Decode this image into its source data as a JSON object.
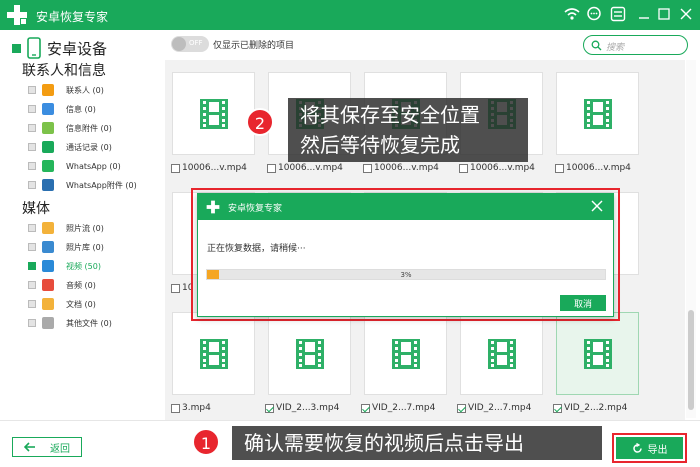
{
  "window": {
    "title": "安卓恢复专家",
    "brand_color": "#19a95a",
    "alert_color": "#e8262e"
  },
  "sidebar": {
    "device_label": "安卓设备",
    "sections": [
      {
        "title": "联系人和信息",
        "items": [
          {
            "label": "联系人 (0)",
            "icon": "contacts-icon",
            "color": "#f39c12"
          },
          {
            "label": "信息 (0)",
            "icon": "message-icon",
            "color": "#3b8de0"
          },
          {
            "label": "信息附件 (0)",
            "icon": "attachment-icon",
            "color": "#7cc24a"
          },
          {
            "label": "通话记录 (0)",
            "icon": "call-log-icon",
            "color": "#19a95a"
          },
          {
            "label": "WhatsApp (0)",
            "icon": "whatsapp-icon",
            "color": "#25b65b"
          },
          {
            "label": "WhatsApp附件 (0)",
            "icon": "whatsapp-attachment-icon",
            "color": "#2a6fb0"
          }
        ]
      },
      {
        "title": "媒体",
        "items": [
          {
            "label": "照片流 (0)",
            "icon": "photo-stream-icon",
            "color": "#f3b23a"
          },
          {
            "label": "照片库 (0)",
            "icon": "photo-library-icon",
            "color": "#3a8ad0"
          },
          {
            "label": "视频 (50)",
            "icon": "video-icon",
            "color": "#2a8ad8",
            "active": true
          },
          {
            "label": "音频 (0)",
            "icon": "audio-icon",
            "color": "#e74c3c"
          },
          {
            "label": "文档 (0)",
            "icon": "document-icon",
            "color": "#f3b23a"
          },
          {
            "label": "其他文件 (0)",
            "icon": "other-files-icon",
            "color": "#aaaaaa"
          }
        ]
      }
    ]
  },
  "topbar": {
    "toggle_label": "OFF",
    "only_deleted_label": "仅显示已删除的项目",
    "search_placeholder": "搜索"
  },
  "grid": {
    "row1": [
      "10006...v.mp4",
      "10006...v.mp4",
      "10006...v.mp4",
      "10006...v.mp4",
      "10006...v.mp4"
    ],
    "row2_first": "10",
    "row3": [
      {
        "label": "3.mp4",
        "checked": false
      },
      {
        "label": "VID_2...3.mp4",
        "checked": true
      },
      {
        "label": "VID_2...7.mp4",
        "checked": true
      },
      {
        "label": "VID_2...7.mp4",
        "checked": true
      },
      {
        "label": "VID_2...2.mp4",
        "checked": true
      }
    ]
  },
  "dialog": {
    "title": "安卓恢复专家",
    "message": "正在恢复数据，请稍候···",
    "progress_percent": 3,
    "progress_label": "3%",
    "cancel_label": "取消"
  },
  "bottombar": {
    "back_label": "返回",
    "export_label": "导出"
  },
  "callouts": {
    "step1_number": "1",
    "step1_text": "确认需要恢复的视频后点击导出",
    "step2_number": "2",
    "step2_line1": "将其保存至安全位置",
    "step2_line2": "然后等待恢复完成"
  }
}
